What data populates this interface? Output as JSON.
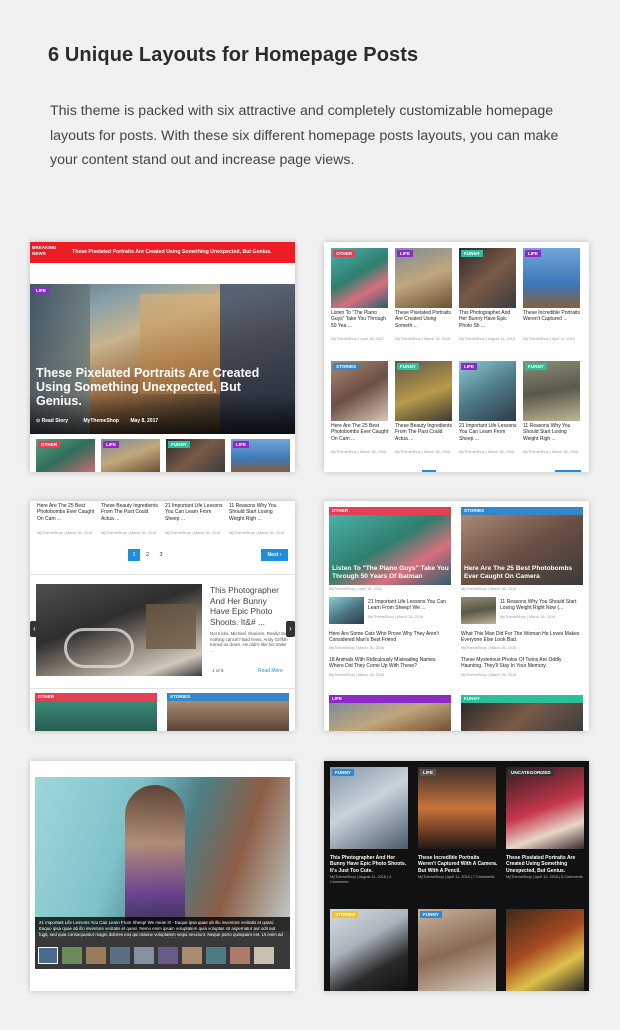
{
  "heading": "6 Unique Layouts for Homepage Posts",
  "intro": "This theme is packed with six attractive and completely customizable homepage layouts for posts. With these six different homepage posts layouts, you can make your content stand out and increase page views.",
  "colors": {
    "breaking_red": "#ee1c24",
    "life_purple": "#8d29c7",
    "other_red": "#e53f53",
    "funny_teal": "#2bbf9a",
    "stories_blue": "#3587c9",
    "accent_blue": "#1e8ed9"
  },
  "layout1": {
    "breaking_label": "BREAKING NEWS",
    "ticker": "These Pixelated Portraits Are Created Using Something Unexpected, But Genius.",
    "hero_cat": "LIFE",
    "hero_title": "These Pixelated Portraits Are Created Using Something Unexpected, But Genius.",
    "read_story": "Read Story",
    "author": "MyThemeShop",
    "date": "May 8, 2017",
    "strip_cats": [
      "OTHER",
      "LIFE",
      "FUNNY",
      "LIFE"
    ]
  },
  "layout2": {
    "posts": [
      {
        "cat": "OTHER",
        "title": "Listen To \"The Piano Guys\" Take You Through 50 Yea ...",
        "meta": "MyThemeShop | June 18, 2017"
      },
      {
        "cat": "LIFE",
        "title": "These Pixelated Portraits Are Created Using Someth ...",
        "meta": "MyThemeShop | March 26, 2016"
      },
      {
        "cat": "FUNNY",
        "title": "This Photographer And Her Bunny Have Epic Photo Sh ...",
        "meta": "MyThemeShop | August 11, 2016"
      },
      {
        "cat": "LIFE",
        "title": "These Incredible Portraits Weren't Captured ...",
        "meta": "MyThemeShop | April 11, 2016"
      },
      {
        "cat": "STORIES",
        "title": "Here Are The 25 Best Photobombs Ever Caught On Cam ...",
        "meta": "MyThemeShop | March 26, 2016"
      },
      {
        "cat": "FUNNY",
        "title": "These Beauty Ingredients From The Past Could Actua ...",
        "meta": "MyThemeShop | March 26, 2016"
      },
      {
        "cat": "LIFE",
        "title": "21 Important Life Lessons You Can Learn From Sheep ...",
        "meta": "MyThemeShop | March 26, 2016"
      },
      {
        "cat": "FUNNY",
        "title": "11 Reasons Why You Should Start Losing Weight Righ ...",
        "meta": "MyThemeShop | March 26, 2016"
      }
    ]
  },
  "layout3": {
    "top_posts": [
      {
        "title": "Here Are The 25 Best Photobombs Ever Caught On Cam ...",
        "meta": "MyThemeShop | March 26, 2016"
      },
      {
        "title": "These Beauty Ingredients From The Past Could Actua ...",
        "meta": "MyThemeShop | March 26, 2016"
      },
      {
        "title": "21 Important Life Lessons You Can Learn From Sheep ...",
        "meta": "MyThemeShop | March 26, 2016"
      },
      {
        "title": "11 Reasons Why You Should Start Losing Weight Righ ...",
        "meta": "MyThemeShop | March 26, 2016"
      }
    ],
    "pages": [
      "1",
      "2",
      "3"
    ],
    "next": "Next ›",
    "slide_title": "This Photographer And Her Bunny Have Epic Photo Shoots. It&# ...",
    "slide_excerpt": "Not tricks. Michael. Illusions. Really! Did nothing cancel? Bad news. Andy Griffith turned us down. He didn't like his trailer ...",
    "slide_count": "1 of 6",
    "read_more": "Read More",
    "bottom_cats": [
      "OTHER",
      "STORIES"
    ]
  },
  "layout4": {
    "left": {
      "cat": "OTHER",
      "title": "Listen To \"The Piano Guys\" Take You Through 50 Years Of Batman",
      "meta": "MyThemeShop | June 18, 2016",
      "side_title": "21 Important Life Lessons You Can Learn From Sheep! We ...",
      "side_meta": "MyThemeShop | March 26, 2016",
      "items": [
        {
          "title": "Here Are Some Cats Who Prove Why They Aren't Considered Man's Best Friend",
          "meta": "MyThemeShop | March 26, 2016"
        },
        {
          "title": "18 Animals With Ridiculously Misleading Names. Where Did They Come Up With These?",
          "meta": "MyThemeShop | March 26, 2016"
        }
      ]
    },
    "right": {
      "cat": "STORIES",
      "title": "Here Are The 25 Best Photobombs Ever Caught On Camera",
      "meta": "MyThemeShop | March 26, 2016",
      "side_title": "11 Reasons Why You Should Start Losing Weight Right Now (...",
      "side_meta": "MyThemeShop | March 26, 2016",
      "items": [
        {
          "title": "What This Man Did For The Woman He Loves Makes Everyone Else Look Bad.",
          "meta": "MyThemeShop | March 26, 2016"
        },
        {
          "title": "These Mysterious Photos Of Twins Are Oddly Haunting. They'll Stay In Your Memory.",
          "meta": "MyThemeShop | March 26, 2016"
        }
      ]
    },
    "bottom_cats": [
      "LIFE",
      "FUNNY"
    ]
  },
  "layout5": {
    "caption_title": "21 Important Life Lessons You Can Learn From Sheep! We mean it! - Eaque ipsa quae ab illo inventore veritatis et quasi. Eaque ipsa quae ab illo inventore veritatis et quasi. Nemo enim ipsam voluptatem quia voluptas sit aspernatur aut odit aut fugit, sed quia consequuntur magni dolores eos qui ratione voluptatem sequi nesciunt. Neque porro quisquam est. Ut enim ad minima veniam, quis nostrum exercitationem ullam corporis suscipit laboriosam."
  },
  "layout6": {
    "posts": [
      {
        "cat": "FUNNY",
        "title": "This Photographer And Her Bunny Have Epic Photo Shoots. It's Just Too Cute.",
        "meta": "MyThemeShop | August 11, 2016 | 4 Comments"
      },
      {
        "cat": "LIFE",
        "title": "These Incredible Portraits Weren't Captured With A Camera. But With A Pencil.",
        "meta": "MyThemeShop | April 11, 2016 | 7 Comments"
      },
      {
        "cat": "UNCATEGORIZED",
        "title": "These Pixelated Portraits Are Created Using Something Unexpected, But Genius.",
        "meta": "MyThemeShop | April 10, 2016 | 5 Comments"
      }
    ],
    "bottom_cats": [
      "STORIES",
      "FUNNY",
      ""
    ]
  }
}
